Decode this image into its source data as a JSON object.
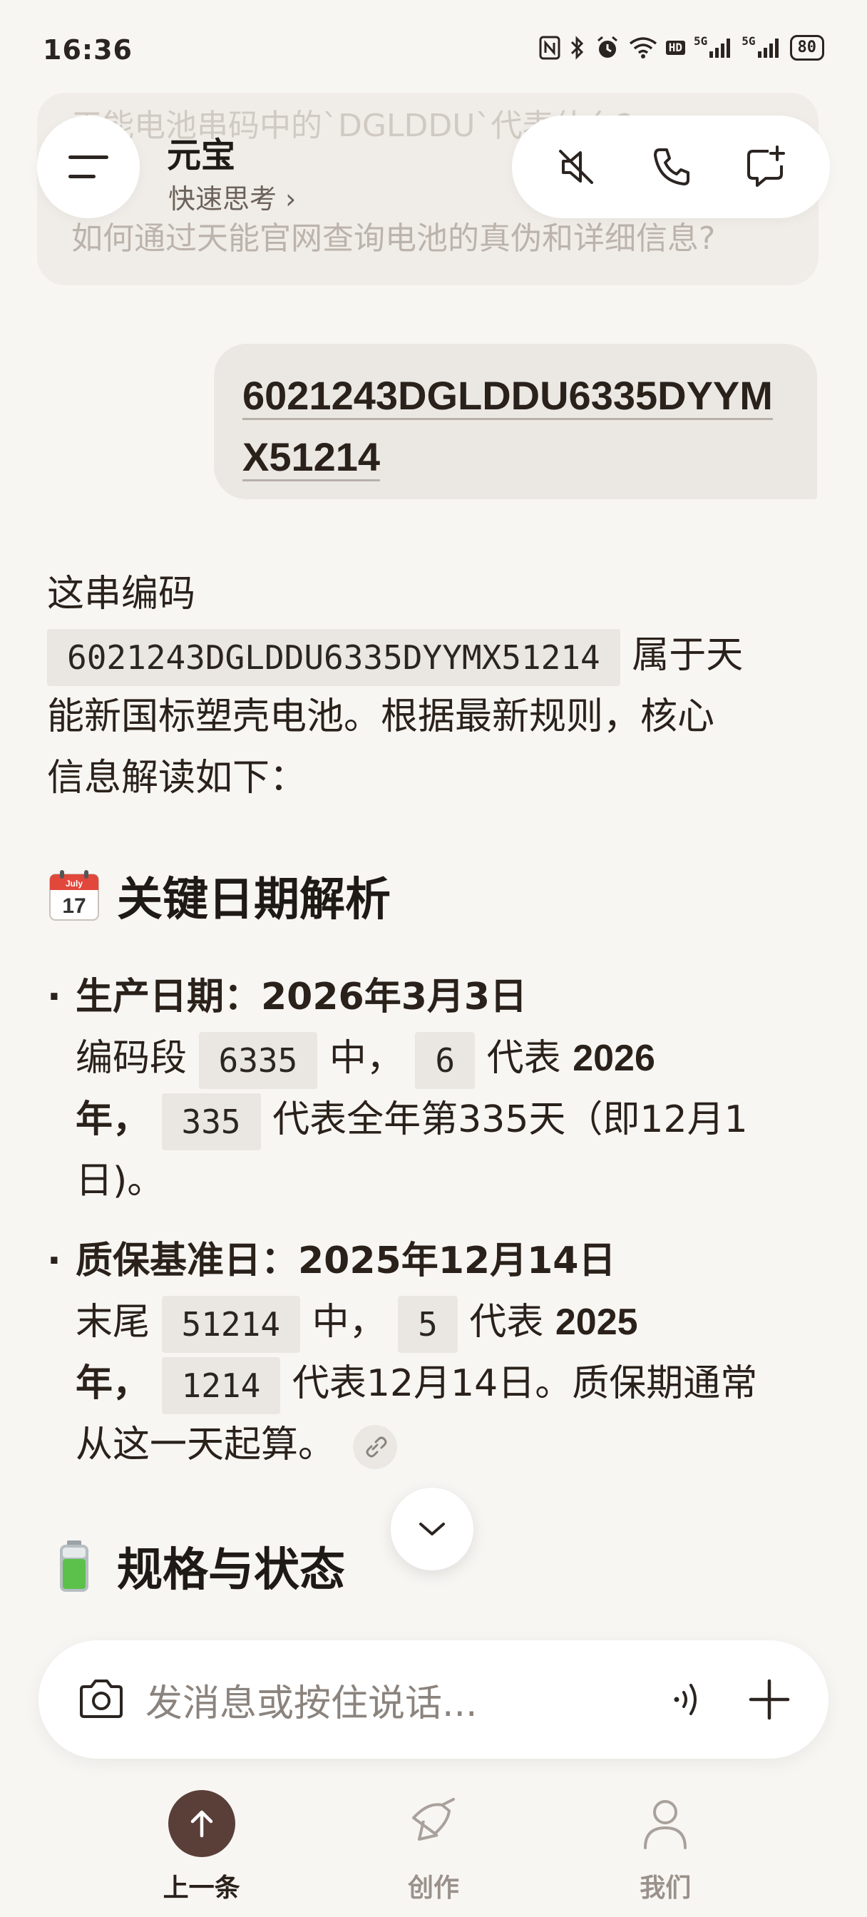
{
  "status_bar": {
    "time": "16:36",
    "network_1": "5G",
    "network_2": "5G",
    "hd_label": "HD",
    "battery": "80"
  },
  "header": {
    "title": "元宝",
    "mode": "快速思考 ›",
    "ghost_question_1": "天能电池串码中的`DGLDDU`代表什么?",
    "ghost_question_2": "如何通过天能官网查询电池的真伪和详细信息?"
  },
  "icons": {
    "menu": "menu-icon",
    "mute": "speaker-muted-icon",
    "call": "phone-icon",
    "new_chat": "new-chat-icon",
    "calendar": "calendar-icon",
    "battery": "battery-icon",
    "link": "link-icon",
    "scroll": "chevron-down-icon",
    "camera": "camera-icon",
    "voice": "voice-wave-icon",
    "plus": "plus-icon",
    "up": "arrow-up-icon",
    "create": "create-pen-icon",
    "me": "person-icon"
  },
  "user_message": {
    "line1": "6021243DGLDDU6335DYYM",
    "line2": "X51214"
  },
  "response": {
    "intro_prefix": "这串编码",
    "intro_code": "6021243DGLDDU6335DYYMX51214",
    "intro_suffix_1": "属于天",
    "intro_line2": "能新国标塑壳电池。根据最新规则，核心",
    "intro_line3": "信息解读如下：",
    "section1_title": "关键日期解析",
    "section1_emoji_month": "July",
    "section1_emoji_day": "17",
    "item1": {
      "title": "生产日期：2026年3月3日",
      "line1_a": "编码段",
      "code_a": "6335",
      "line1_b": "中，",
      "code_b": "6",
      "line1_c": "代表",
      "line1_bold": "2026",
      "line2_bold": "年，",
      "code_c": "335",
      "line2_rest": "代表全年第335天（即12月1",
      "line3": "日)。"
    },
    "item2": {
      "title": "质保基准日：2025年12月14日",
      "line1_a": "末尾",
      "code_a": "51214",
      "line1_b": "中，",
      "code_b": "5",
      "line1_c": "代表",
      "line1_bold": "2025",
      "line2_bold": "年，",
      "code_c": "1214",
      "line2_rest": "代表12月14日。质保期通常",
      "line3": "从这一天起算。"
    },
    "section2_title": "规格与状态"
  },
  "input": {
    "placeholder": "发消息或按住说话..."
  },
  "nav": {
    "items": [
      {
        "label": "上一条"
      },
      {
        "label": "创作"
      },
      {
        "label": "我们"
      }
    ]
  },
  "colors": {
    "background": "#f8f6f3",
    "accent": "#5a3f39",
    "text": "#2a211b",
    "muted": "#8b837d"
  }
}
